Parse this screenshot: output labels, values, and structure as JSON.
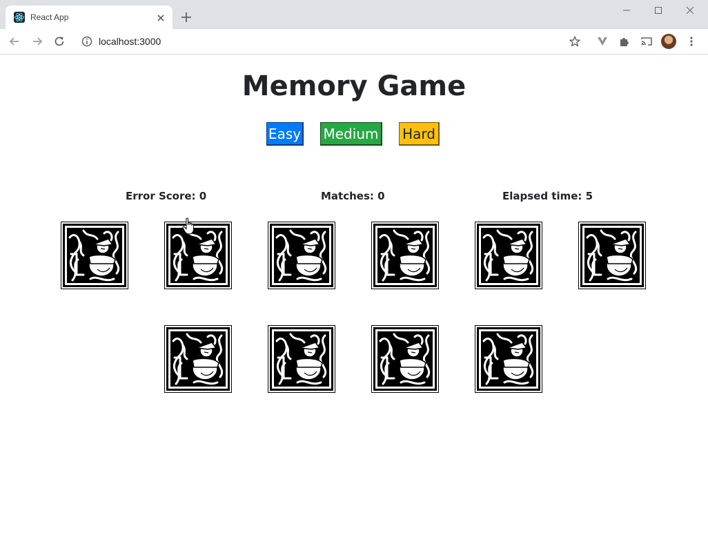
{
  "browser": {
    "tab_title": "React App",
    "url": "localhost:3000",
    "icons": [
      "react-favicon",
      "close-icon",
      "plus-icon",
      "minimize-icon",
      "maximize-icon",
      "window-close-icon",
      "back-icon",
      "forward-icon",
      "reload-icon",
      "info-icon",
      "star-icon",
      "extension-v-icon",
      "puzzle-icon",
      "cast-icon",
      "avatar",
      "menu-icon"
    ]
  },
  "page": {
    "title": "Memory Game",
    "levels": {
      "easy": "Easy",
      "medium": "Medium",
      "hard": "Hard"
    },
    "stats": {
      "error_score": "Error Score: 0",
      "matches": "Matches: 0",
      "elapsed": "Elapsed time: 5"
    },
    "cards": {
      "count": 10,
      "state": "face-down",
      "back_image": "celtic-knotwork-monk-illustration"
    }
  },
  "colors": {
    "easy": "#007bff",
    "medium": "#28a745",
    "hard": "#ffc107",
    "text": "#212529"
  }
}
